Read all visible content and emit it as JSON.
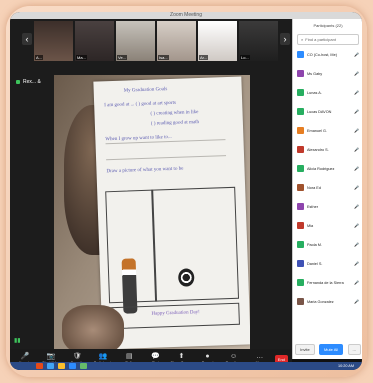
{
  "window": {
    "title": "Zoom Meeting"
  },
  "gallery": {
    "thumbnails": [
      {
        "name": "A...",
        "cls": "t1"
      },
      {
        "name": "Ma...",
        "cls": "t2"
      },
      {
        "name": "Ve...",
        "cls": "t3"
      },
      {
        "name": "Isa...",
        "cls": "t4"
      },
      {
        "name": "Ar...",
        "cls": "t5"
      },
      {
        "name": "Lo...",
        "cls": "t6"
      }
    ]
  },
  "speaker": {
    "label": "Rex... &"
  },
  "worksheet": {
    "lines": [
      "My Graduation Goals",
      "I am good at ... ( ) good at art sports",
      "( ) creating when in  like",
      "( ) reading good at math",
      "When I grow up want to like to...",
      "Draw a picture of what you want to be",
      "Happy Graduation Day!"
    ]
  },
  "toolbar": {
    "items": [
      {
        "label": "Unmute",
        "icon": "🎤",
        "name": "unmute-button"
      },
      {
        "label": "Start Video",
        "icon": "📷",
        "name": "start-video-button"
      },
      {
        "label": "Security",
        "icon": "🛡",
        "name": "security-button"
      },
      {
        "label": "Participants",
        "icon": "👥",
        "name": "participants-button"
      },
      {
        "label": "Polls",
        "icon": "▤",
        "name": "polls-button"
      },
      {
        "label": "Chat",
        "icon": "💬",
        "name": "chat-button"
      },
      {
        "label": "Share Screen",
        "icon": "⬆",
        "name": "share-screen-button"
      },
      {
        "label": "Record",
        "icon": "●",
        "name": "record-button"
      },
      {
        "label": "Reactions",
        "icon": "☺",
        "name": "reactions-button"
      },
      {
        "label": "More",
        "icon": "…",
        "name": "more-button"
      }
    ],
    "end_label": "End"
  },
  "participants": {
    "title": "Participants (22)",
    "search_placeholder": "Find a participant",
    "rows": [
      {
        "name": "CO (Co-host, Me)",
        "color": "#2d8cff"
      },
      {
        "name": "Ms Gaby",
        "color": "#8e44ad"
      },
      {
        "name": "Lunas A.",
        "color": "#27ae60"
      },
      {
        "name": "Lucas DAVON",
        "color": "#27ae60"
      },
      {
        "name": "Emanuel G.",
        "color": "#e67e22"
      },
      {
        "name": "Alexandro S.",
        "color": "#c0392b"
      },
      {
        "name": "Alicia Rodriguez",
        "color": "#27ae60"
      },
      {
        "name": "Nora Ed",
        "color": "#a0522d"
      },
      {
        "name": "Esther",
        "color": "#8e44ad"
      },
      {
        "name": "Mia",
        "color": "#c0392b"
      },
      {
        "name": "Paola M.",
        "color": "#27ae60"
      },
      {
        "name": "Daniel S.",
        "color": "#3f51b5"
      },
      {
        "name": "Fernanda de la Sierra",
        "color": "#27ae60"
      },
      {
        "name": "Maria Gonzalez",
        "color": "#795548"
      }
    ],
    "footer": {
      "invite": "Invite",
      "mute_all": "Mute All",
      "more": "..."
    }
  },
  "taskbar": {
    "time": "10:20 AM"
  }
}
